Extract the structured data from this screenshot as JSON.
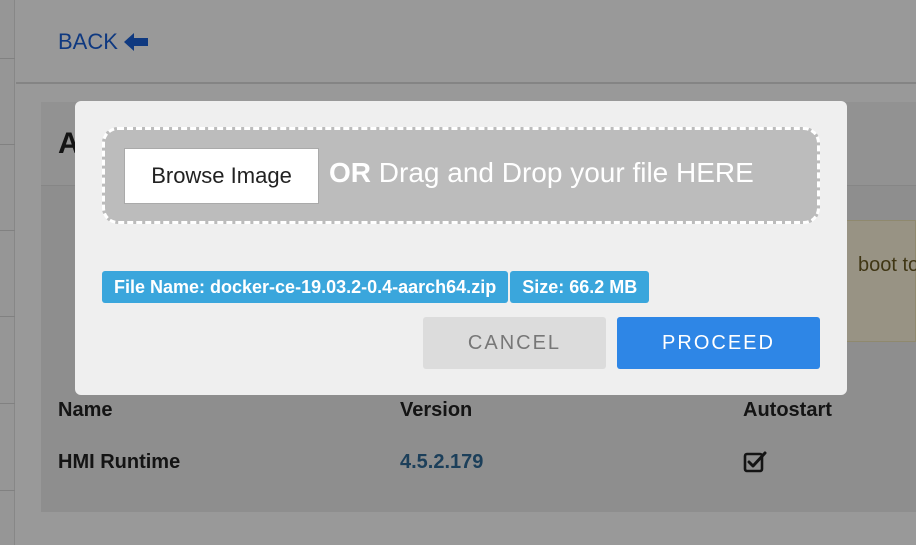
{
  "header": {
    "back_label": "BACK"
  },
  "content": {
    "title": "A",
    "notice_text": "boot to",
    "table": {
      "columns": [
        "Name",
        "Version",
        "Autostart"
      ],
      "rows": [
        {
          "name": "HMI Runtime",
          "version": "4.5.2.179",
          "autostart": true
        }
      ]
    }
  },
  "modal": {
    "browse_label": "Browse Image",
    "drop_or": "OR",
    "drop_text": "Drag and Drop your file HERE",
    "file_name_badge": "File Name: docker-ce-19.03.2-0.4-aarch64.zip",
    "size_badge": "Size: 66.2 MB",
    "cancel_label": "CANCEL",
    "proceed_label": "PROCEED"
  },
  "colors": {
    "accent": "#2e86e6",
    "badge": "#3aa6dc",
    "link": "#1a5fd6"
  },
  "icons": {
    "back": "arrow-left-icon",
    "autostart": "checked-box-icon"
  }
}
